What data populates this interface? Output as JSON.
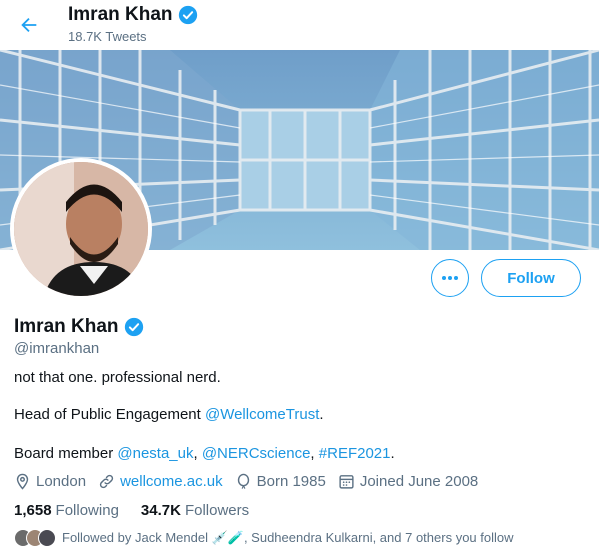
{
  "header": {
    "name": "Imran Khan",
    "tweet_count": "18.7K Tweets"
  },
  "profile": {
    "name": "Imran Khan",
    "handle": "@imrankhan",
    "follow_label": "Follow"
  },
  "bio": {
    "line1": "not that one. professional nerd.",
    "line2_prefix": "Head of Public Engagement ",
    "line2_link": "@WellcomeTrust",
    "line2_suffix": ".",
    "line3_prefix": "Board member ",
    "line3_link1": "@nesta_uk",
    "line3_sep1": ", ",
    "line3_link2": "@NERCscience",
    "line3_sep2": ", ",
    "line3_link3": "#REF2021",
    "line3_suffix": "."
  },
  "meta": {
    "location": "London",
    "website": "wellcome.ac.uk",
    "birth": "Born 1985",
    "joined": "Joined June 2008"
  },
  "stats": {
    "following_count": "1,658",
    "following_label": "Following",
    "followers_count": "34.7K",
    "followers_label": "Followers"
  },
  "followed_by": {
    "text": "Followed by Jack Mendel 💉🧪, Sudheendra Kulkarni, and 7 others you follow"
  },
  "colors": {
    "accent": "#1da1f2",
    "link": "#1b95e0",
    "secondary_text": "#5b7083"
  },
  "icons": [
    "back-arrow-icon",
    "verified-badge-icon",
    "more-icon",
    "location-icon",
    "link-icon",
    "balloon-icon",
    "calendar-icon"
  ]
}
